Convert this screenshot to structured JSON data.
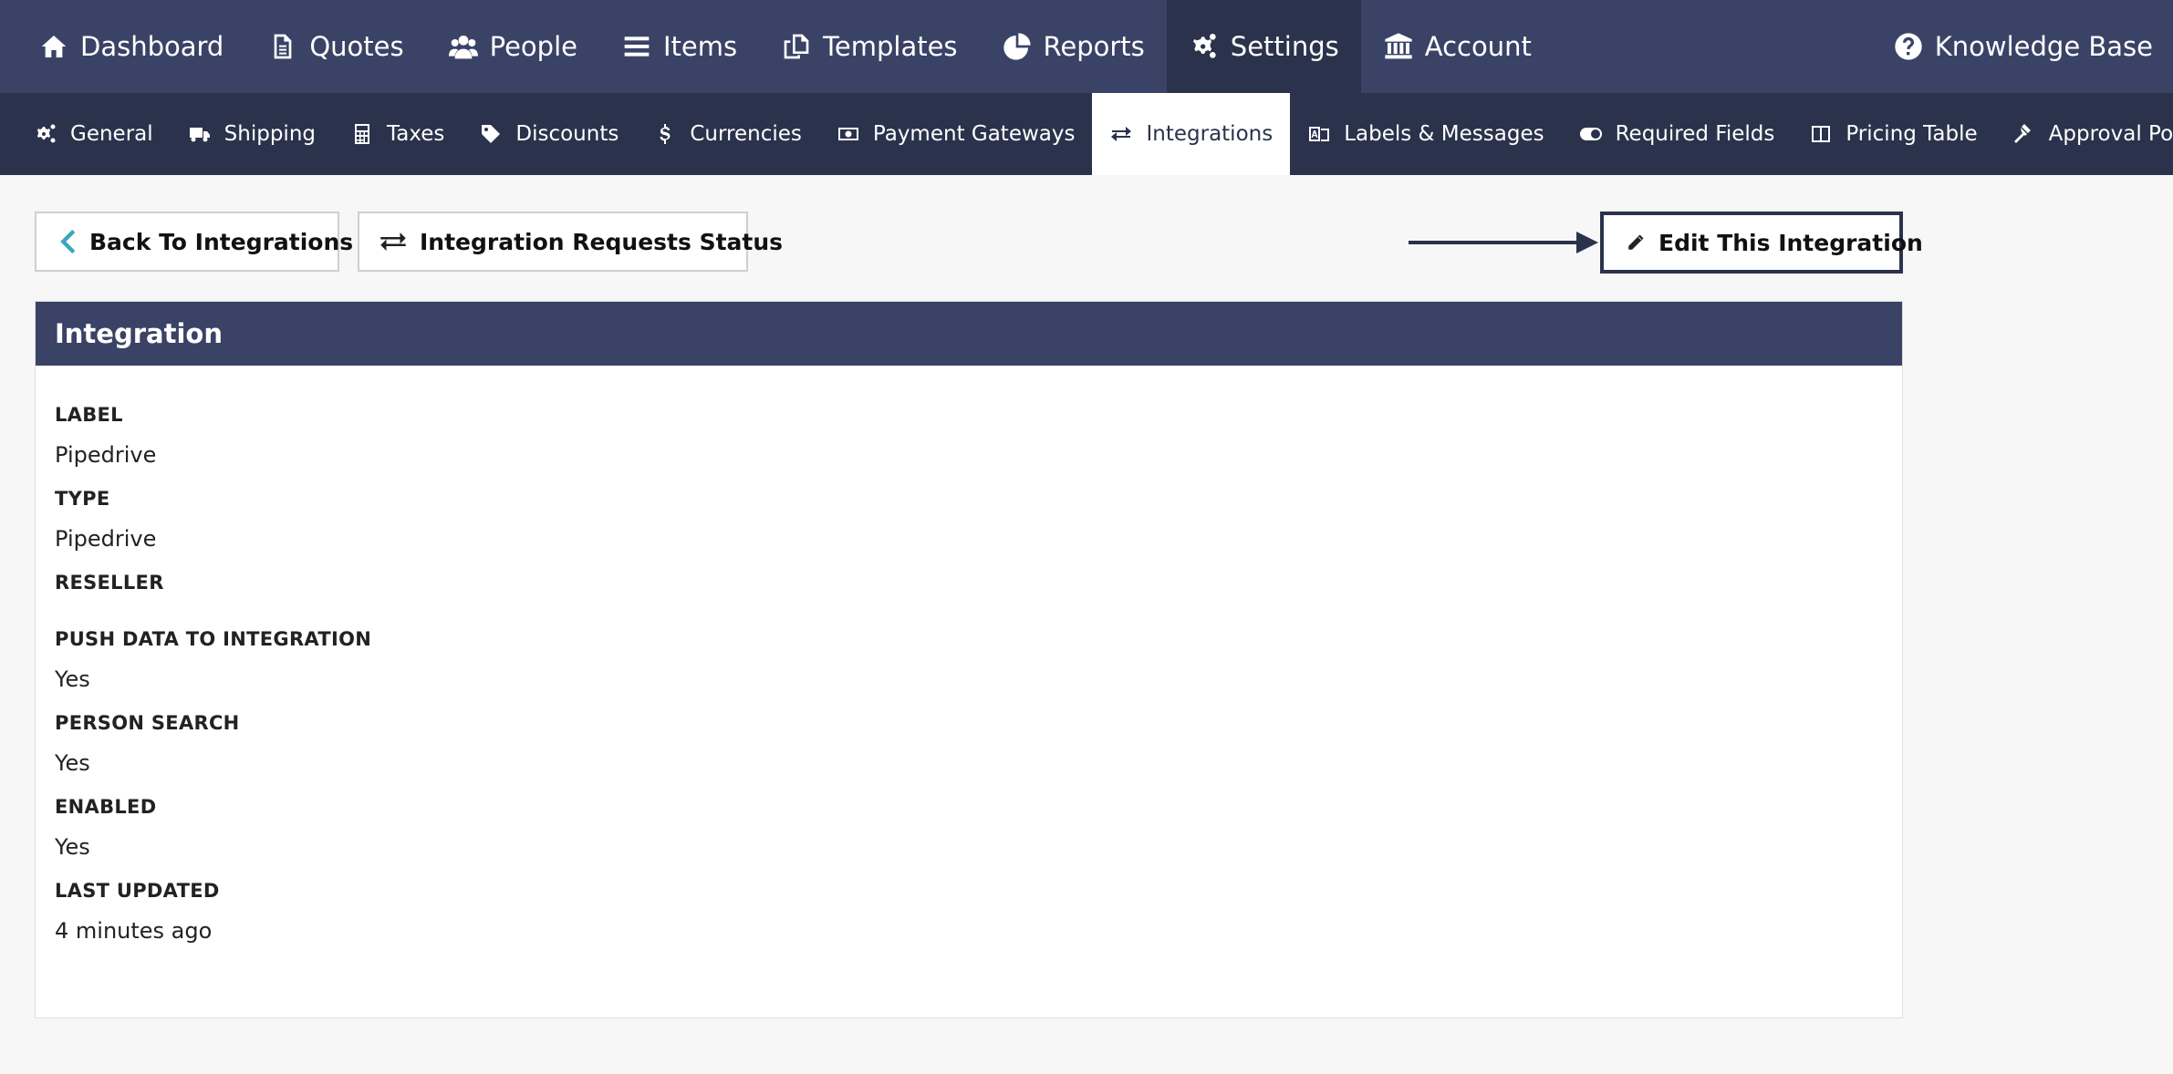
{
  "topnav": {
    "items": [
      {
        "label": "Dashboard",
        "icon": "home-icon"
      },
      {
        "label": "Quotes",
        "icon": "document-icon"
      },
      {
        "label": "People",
        "icon": "users-icon"
      },
      {
        "label": "Items",
        "icon": "list-icon"
      },
      {
        "label": "Templates",
        "icon": "copy-icon"
      },
      {
        "label": "Reports",
        "icon": "pie-chart-icon"
      },
      {
        "label": "Settings",
        "icon": "gears-icon",
        "active": true
      },
      {
        "label": "Account",
        "icon": "bank-icon"
      }
    ],
    "knowledge_base": "Knowledge Base"
  },
  "subnav": {
    "items": [
      {
        "label": "General",
        "icon": "gears-icon"
      },
      {
        "label": "Shipping",
        "icon": "truck-icon"
      },
      {
        "label": "Taxes",
        "icon": "calculator-icon"
      },
      {
        "label": "Discounts",
        "icon": "tag-icon"
      },
      {
        "label": "Currencies",
        "icon": "dollar-icon"
      },
      {
        "label": "Payment Gateways",
        "icon": "money-icon"
      },
      {
        "label": "Integrations",
        "icon": "exchange-icon",
        "active": true
      },
      {
        "label": "Labels & Messages",
        "icon": "language-icon"
      },
      {
        "label": "Required Fields",
        "icon": "toggle-icon"
      },
      {
        "label": "Pricing Table",
        "icon": "columns-icon"
      },
      {
        "label": "Approval Policies",
        "icon": "gavel-icon"
      }
    ]
  },
  "actions": {
    "back_label": "Back To Integrations",
    "status_label": "Integration Requests Status",
    "edit_label": "Edit This Integration"
  },
  "panel": {
    "title": "Integration",
    "fields": [
      {
        "label": "LABEL",
        "value": "Pipedrive"
      },
      {
        "label": "TYPE",
        "value": "Pipedrive"
      },
      {
        "label": "RESELLER",
        "value": ""
      },
      {
        "label": "PUSH DATA TO INTEGRATION",
        "value": "Yes"
      },
      {
        "label": "PERSON SEARCH",
        "value": "Yes"
      },
      {
        "label": "ENABLED",
        "value": "Yes"
      },
      {
        "label": "LAST UPDATED",
        "value": "4 minutes ago"
      }
    ]
  },
  "colors": {
    "nav_primary": "#3a4366",
    "nav_secondary": "#2b324c",
    "back_chevron": "#3aa6b9"
  }
}
